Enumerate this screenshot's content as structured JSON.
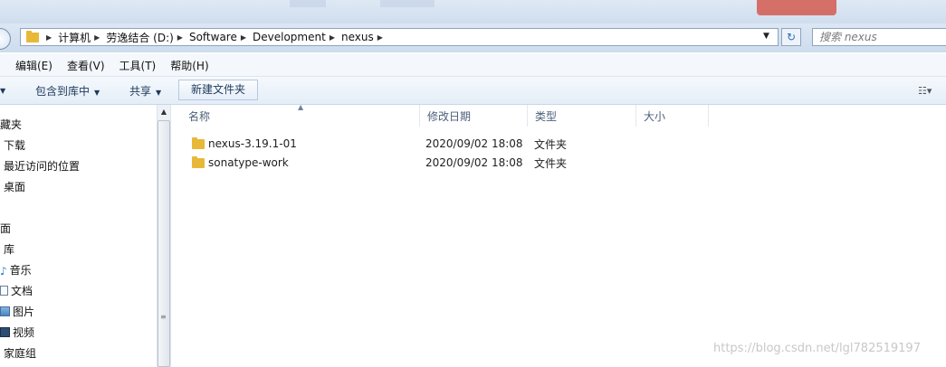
{
  "address": {
    "crumbs": [
      "计算机",
      "劳逸结合 (D:)",
      "Software",
      "Development",
      "nexus"
    ],
    "search_placeholder": "搜索 nexus"
  },
  "menu": [
    "编辑(E)",
    "查看(V)",
    "工具(T)",
    "帮助(H)"
  ],
  "toolbar": {
    "include_library": "包含到库中",
    "share": "共享",
    "new_folder": "新建文件夹"
  },
  "nav": {
    "favorites": "收藏夹",
    "downloads": "下载",
    "recent": "最近访问的位置",
    "desktop_fav": "桌面",
    "desktop": "桌面",
    "libraries": "库",
    "music": "音乐",
    "documents": "文档",
    "pictures": "图片",
    "videos": "视频",
    "homegroup": "家庭组"
  },
  "columns": {
    "name": "名称",
    "date": "修改日期",
    "type": "类型",
    "size": "大小"
  },
  "files": [
    {
      "name": "nexus-3.19.1-01",
      "date": "2020/09/02 18:08",
      "type": "文件夹",
      "size": ""
    },
    {
      "name": "sonatype-work",
      "date": "2020/09/02 18:08",
      "type": "文件夹",
      "size": ""
    }
  ],
  "watermark": "https://blog.csdn.net/lgl782519197"
}
